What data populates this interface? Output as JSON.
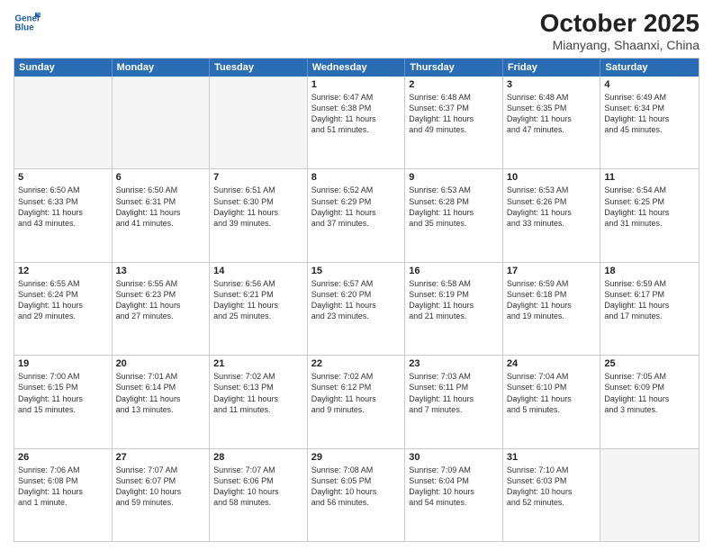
{
  "header": {
    "logo_line1": "General",
    "logo_line2": "Blue",
    "month": "October 2025",
    "location": "Mianyang, Shaanxi, China"
  },
  "day_headers": [
    "Sunday",
    "Monday",
    "Tuesday",
    "Wednesday",
    "Thursday",
    "Friday",
    "Saturday"
  ],
  "weeks": [
    [
      {
        "num": "",
        "info": ""
      },
      {
        "num": "",
        "info": ""
      },
      {
        "num": "",
        "info": ""
      },
      {
        "num": "1",
        "info": "Sunrise: 6:47 AM\nSunset: 6:38 PM\nDaylight: 11 hours\nand 51 minutes."
      },
      {
        "num": "2",
        "info": "Sunrise: 6:48 AM\nSunset: 6:37 PM\nDaylight: 11 hours\nand 49 minutes."
      },
      {
        "num": "3",
        "info": "Sunrise: 6:48 AM\nSunset: 6:35 PM\nDaylight: 11 hours\nand 47 minutes."
      },
      {
        "num": "4",
        "info": "Sunrise: 6:49 AM\nSunset: 6:34 PM\nDaylight: 11 hours\nand 45 minutes."
      }
    ],
    [
      {
        "num": "5",
        "info": "Sunrise: 6:50 AM\nSunset: 6:33 PM\nDaylight: 11 hours\nand 43 minutes."
      },
      {
        "num": "6",
        "info": "Sunrise: 6:50 AM\nSunset: 6:31 PM\nDaylight: 11 hours\nand 41 minutes."
      },
      {
        "num": "7",
        "info": "Sunrise: 6:51 AM\nSunset: 6:30 PM\nDaylight: 11 hours\nand 39 minutes."
      },
      {
        "num": "8",
        "info": "Sunrise: 6:52 AM\nSunset: 6:29 PM\nDaylight: 11 hours\nand 37 minutes."
      },
      {
        "num": "9",
        "info": "Sunrise: 6:53 AM\nSunset: 6:28 PM\nDaylight: 11 hours\nand 35 minutes."
      },
      {
        "num": "10",
        "info": "Sunrise: 6:53 AM\nSunset: 6:26 PM\nDaylight: 11 hours\nand 33 minutes."
      },
      {
        "num": "11",
        "info": "Sunrise: 6:54 AM\nSunset: 6:25 PM\nDaylight: 11 hours\nand 31 minutes."
      }
    ],
    [
      {
        "num": "12",
        "info": "Sunrise: 6:55 AM\nSunset: 6:24 PM\nDaylight: 11 hours\nand 29 minutes."
      },
      {
        "num": "13",
        "info": "Sunrise: 6:55 AM\nSunset: 6:23 PM\nDaylight: 11 hours\nand 27 minutes."
      },
      {
        "num": "14",
        "info": "Sunrise: 6:56 AM\nSunset: 6:21 PM\nDaylight: 11 hours\nand 25 minutes."
      },
      {
        "num": "15",
        "info": "Sunrise: 6:57 AM\nSunset: 6:20 PM\nDaylight: 11 hours\nand 23 minutes."
      },
      {
        "num": "16",
        "info": "Sunrise: 6:58 AM\nSunset: 6:19 PM\nDaylight: 11 hours\nand 21 minutes."
      },
      {
        "num": "17",
        "info": "Sunrise: 6:59 AM\nSunset: 6:18 PM\nDaylight: 11 hours\nand 19 minutes."
      },
      {
        "num": "18",
        "info": "Sunrise: 6:59 AM\nSunset: 6:17 PM\nDaylight: 11 hours\nand 17 minutes."
      }
    ],
    [
      {
        "num": "19",
        "info": "Sunrise: 7:00 AM\nSunset: 6:15 PM\nDaylight: 11 hours\nand 15 minutes."
      },
      {
        "num": "20",
        "info": "Sunrise: 7:01 AM\nSunset: 6:14 PM\nDaylight: 11 hours\nand 13 minutes."
      },
      {
        "num": "21",
        "info": "Sunrise: 7:02 AM\nSunset: 6:13 PM\nDaylight: 11 hours\nand 11 minutes."
      },
      {
        "num": "22",
        "info": "Sunrise: 7:02 AM\nSunset: 6:12 PM\nDaylight: 11 hours\nand 9 minutes."
      },
      {
        "num": "23",
        "info": "Sunrise: 7:03 AM\nSunset: 6:11 PM\nDaylight: 11 hours\nand 7 minutes."
      },
      {
        "num": "24",
        "info": "Sunrise: 7:04 AM\nSunset: 6:10 PM\nDaylight: 11 hours\nand 5 minutes."
      },
      {
        "num": "25",
        "info": "Sunrise: 7:05 AM\nSunset: 6:09 PM\nDaylight: 11 hours\nand 3 minutes."
      }
    ],
    [
      {
        "num": "26",
        "info": "Sunrise: 7:06 AM\nSunset: 6:08 PM\nDaylight: 11 hours\nand 1 minute."
      },
      {
        "num": "27",
        "info": "Sunrise: 7:07 AM\nSunset: 6:07 PM\nDaylight: 10 hours\nand 59 minutes."
      },
      {
        "num": "28",
        "info": "Sunrise: 7:07 AM\nSunset: 6:06 PM\nDaylight: 10 hours\nand 58 minutes."
      },
      {
        "num": "29",
        "info": "Sunrise: 7:08 AM\nSunset: 6:05 PM\nDaylight: 10 hours\nand 56 minutes."
      },
      {
        "num": "30",
        "info": "Sunrise: 7:09 AM\nSunset: 6:04 PM\nDaylight: 10 hours\nand 54 minutes."
      },
      {
        "num": "31",
        "info": "Sunrise: 7:10 AM\nSunset: 6:03 PM\nDaylight: 10 hours\nand 52 minutes."
      },
      {
        "num": "",
        "info": ""
      }
    ]
  ]
}
